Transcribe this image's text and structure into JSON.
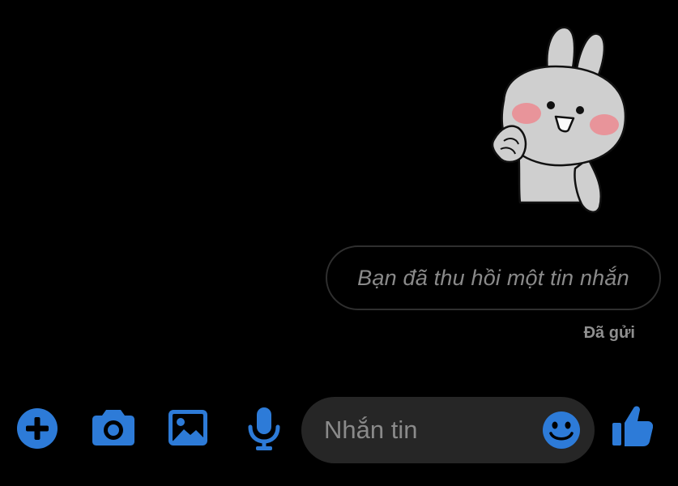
{
  "conversation": {
    "sticker": {
      "icon": "waving-bunny-sticker"
    },
    "recalled_message": {
      "text": "Bạn đã thu hồi một tin nhắn"
    },
    "status": "Đã gửi"
  },
  "composer": {
    "placeholder": "Nhắn tin",
    "value": "",
    "accent_color": "#2d7bd8",
    "field_color": "#262626",
    "icons": {
      "add": "plus-circle-icon",
      "camera": "camera-icon",
      "gallery": "image-icon",
      "voice": "microphone-icon",
      "emoji": "smiley-icon",
      "like": "thumbs-up-icon"
    }
  }
}
